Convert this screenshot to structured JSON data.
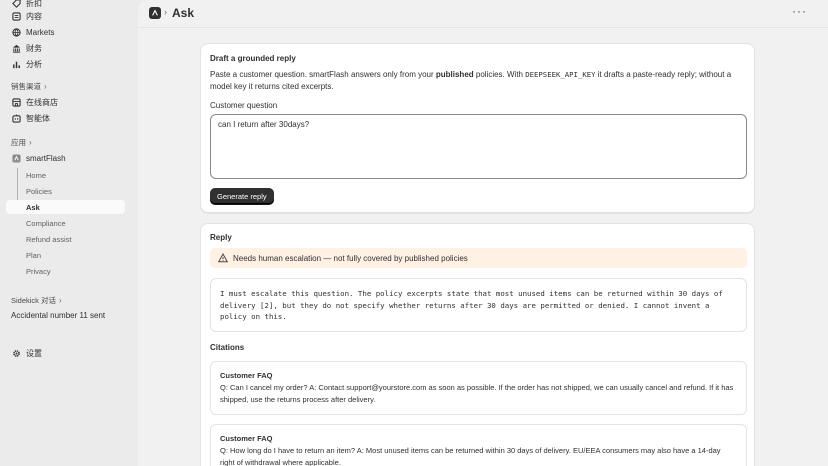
{
  "sidebar": {
    "items": [
      {
        "label": "折扣",
        "icon": "discount-icon"
      },
      {
        "label": "内容",
        "icon": "content-icon"
      },
      {
        "label": "Markets",
        "icon": "globe-icon"
      },
      {
        "label": "财务",
        "icon": "bank-icon"
      },
      {
        "label": "分析",
        "icon": "chart-icon"
      }
    ],
    "sales_channels_label": "销售渠道",
    "channels": [
      {
        "label": "在线商店",
        "icon": "store-icon"
      },
      {
        "label": "智能体",
        "icon": "agent-icon"
      }
    ],
    "apps_label": "应用",
    "app_name": "smartFlash",
    "app_subitems": [
      "Home",
      "Policies",
      "Ask",
      "Compliance",
      "Refund assist",
      "Plan",
      "Privacy"
    ],
    "sidekick_label": "Sidekick 对话",
    "toast": "Accidental number 11 sent",
    "settings_label": "设置"
  },
  "header": {
    "title": "Ask",
    "more": "···"
  },
  "draft_card": {
    "title": "Draft a grounded reply",
    "desc_part1": "Paste a customer question. smartFlash answers only from your ",
    "desc_bold": "published",
    "desc_part2": " policies. With ",
    "desc_code": "DEEPSEEK_API_KEY",
    "desc_part3": " it drafts a paste-ready reply; without a model key it returns cited excerpts.",
    "field_label": "Customer question",
    "question_value": "can I return after 30days?",
    "button_label": "Generate reply"
  },
  "reply_card": {
    "title": "Reply",
    "warning": "Needs human escalation — not fully covered by published policies",
    "reply_text": "I must escalate this question. The policy excerpts state that most unused items can be returned within 30 days of delivery [2], but they do not specify whether returns after 30 days are permitted or denied. I cannot invent a policy on this.",
    "citations_label": "Citations",
    "citations": [
      {
        "title": "Customer FAQ",
        "body": "Q: Can I cancel my order? A: Contact support@yourstore.com as soon as possible. If the order has not shipped, we can usually cancel and refund. If it has shipped, use the returns process after delivery."
      },
      {
        "title": "Customer FAQ",
        "body": "Q: How long do I have to return an item? A: Most unused items can be returned within 30 days of delivery. EU/EEA consumers may also have a 14-day right of withdrawal where applicable."
      }
    ]
  },
  "colors": {
    "sidebar_bg": "#ebebeb",
    "main_bg": "#f1f1f1",
    "button_bg": "#303030",
    "warning_bg": "#fff1e3"
  }
}
